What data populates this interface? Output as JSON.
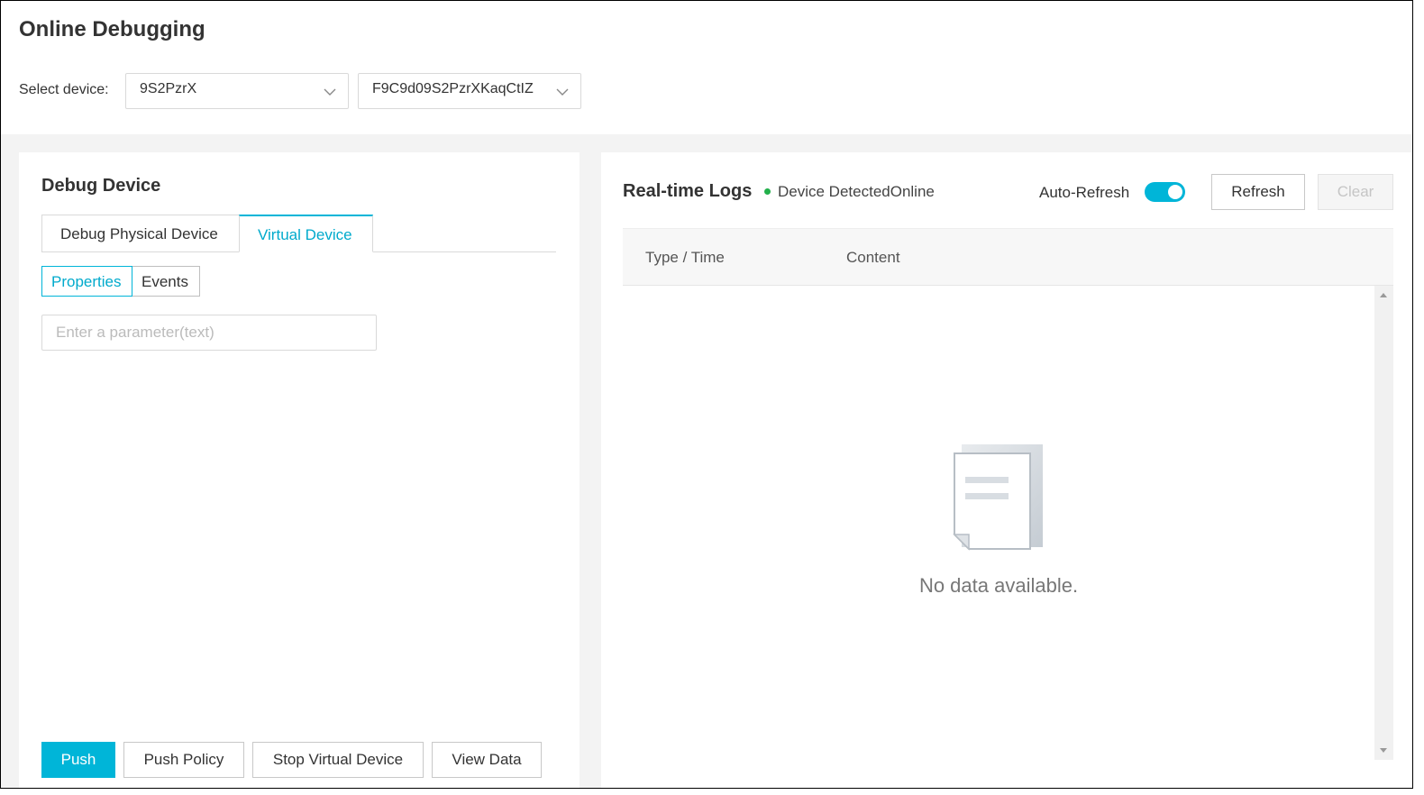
{
  "header": {
    "title": "Online Debugging",
    "select_label": "Select device:",
    "product_select": {
      "value": "9S2PzrX"
    },
    "device_select": {
      "value": "F9C9d09S2PzrXKaqCtIZ"
    }
  },
  "left_panel": {
    "title": "Debug Device",
    "tabs": [
      {
        "label": "Debug Physical Device",
        "active": false
      },
      {
        "label": "Virtual Device",
        "active": true
      }
    ],
    "segments": [
      {
        "label": "Properties",
        "active": true
      },
      {
        "label": "Events",
        "active": false
      }
    ],
    "param_input": {
      "placeholder": "Enter a parameter(text)",
      "value": ""
    },
    "buttons": {
      "push": "Push",
      "push_policy": "Push Policy",
      "stop_virtual": "Stop Virtual Device",
      "view_data": "View Data"
    }
  },
  "right_panel": {
    "title": "Real-time Logs",
    "status": {
      "text": "Device DetectedOnline",
      "color": "#22b04b"
    },
    "auto_refresh": {
      "label": "Auto-Refresh",
      "enabled": true
    },
    "buttons": {
      "refresh": "Refresh",
      "clear": "Clear"
    },
    "table": {
      "columns": [
        "Type / Time",
        "Content"
      ],
      "empty_text": "No data available."
    }
  },
  "colors": {
    "accent": "#00b5d8"
  }
}
